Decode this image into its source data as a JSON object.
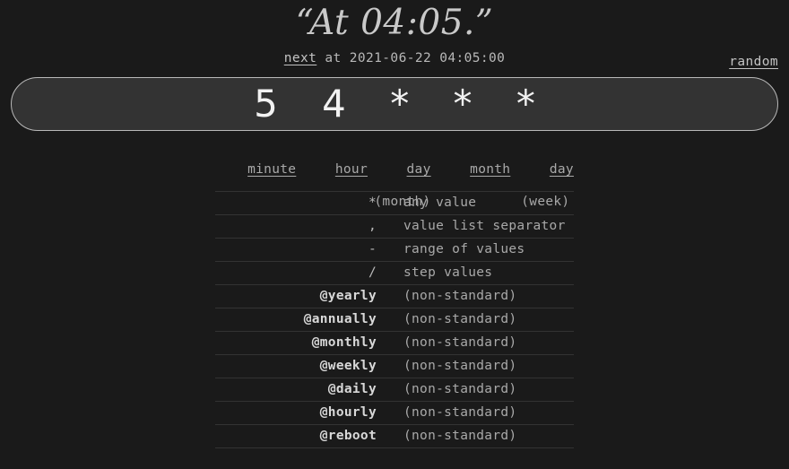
{
  "header": {
    "description": "“At 04:05.”",
    "next_link_label": "next",
    "next_text": " at 2021-06-22 04:05:00",
    "random_link_label": "random"
  },
  "cron_input": {
    "value": "5 4 * * *",
    "placeholder": "* * * * *"
  },
  "fields": [
    {
      "name": "minute",
      "sub": ""
    },
    {
      "name": "hour",
      "sub": ""
    },
    {
      "name": "day",
      "sub": "(month)"
    },
    {
      "name": "month",
      "sub": ""
    },
    {
      "name": "day",
      "sub": "(week)"
    }
  ],
  "legend": [
    {
      "symbol": "*",
      "description": "any value",
      "special": false
    },
    {
      "symbol": ",",
      "description": "value list separator",
      "special": false
    },
    {
      "symbol": "-",
      "description": "range of values",
      "special": false
    },
    {
      "symbol": "/",
      "description": "step values",
      "special": false
    },
    {
      "symbol": "@yearly",
      "description": "(non-standard)",
      "special": true
    },
    {
      "symbol": "@annually",
      "description": "(non-standard)",
      "special": true
    },
    {
      "symbol": "@monthly",
      "description": "(non-standard)",
      "special": true
    },
    {
      "symbol": "@weekly",
      "description": "(non-standard)",
      "special": true
    },
    {
      "symbol": "@daily",
      "description": "(non-standard)",
      "special": true
    },
    {
      "symbol": "@hourly",
      "description": "(non-standard)",
      "special": true
    },
    {
      "symbol": "@reboot",
      "description": "(non-standard)",
      "special": true
    }
  ],
  "colors": {
    "background": "#1a1a1a",
    "input_fill": "#333333",
    "input_border": "#b9b9b9",
    "text": "#d8d8d8",
    "muted_text": "#a9a9a9",
    "row_divider": "#333333"
  }
}
